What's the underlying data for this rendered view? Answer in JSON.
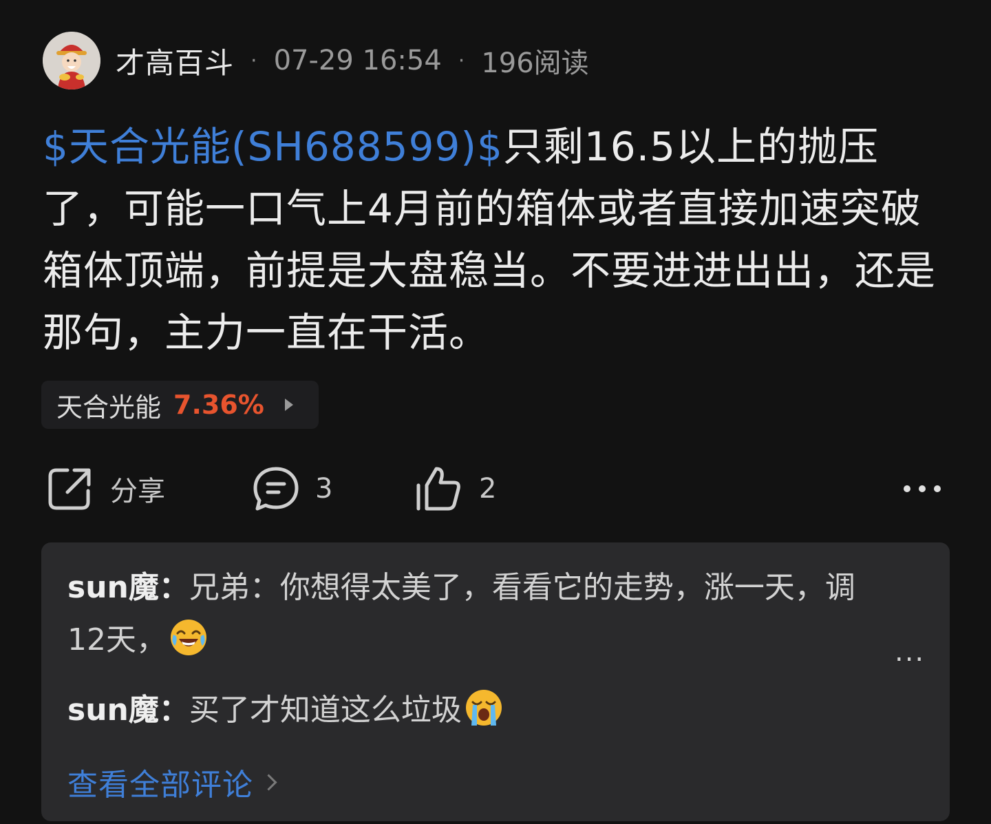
{
  "post": {
    "author": "才高百斗",
    "time": "07-29 16:54",
    "reads": "196阅读",
    "separator": "·",
    "stock_tag": "$天合光能(SH688599)$",
    "body": "只剩16.5以上的抛压了，可能一口气上4月前的箱体或者直接加速突破箱体顶端，前提是大盘稳当。不要进进出出，还是那句，主力一直在干活。"
  },
  "stock_chip": {
    "name": "天合光能",
    "change": "7.36%",
    "change_color": "#e8542e"
  },
  "actions": {
    "share_label": "分享",
    "comment_count": "3",
    "like_count": "2"
  },
  "comments": {
    "items": [
      {
        "user": "sun魔",
        "colon": "：",
        "text": "兄弟：你想得太美了，看看它的走势，涨一天，调12天，",
        "emoji": "laughing-crying-emoji"
      },
      {
        "user": "sun魔",
        "colon": "：",
        "text": "买了才知道这么垃圾",
        "emoji": "loudly-crying-emoji"
      }
    ],
    "more": "...",
    "view_all": "查看全部评论"
  },
  "colors": {
    "background": "#121212",
    "link": "#3f7fd8",
    "rise": "#e8542e",
    "panel": "#2a2a2c"
  }
}
